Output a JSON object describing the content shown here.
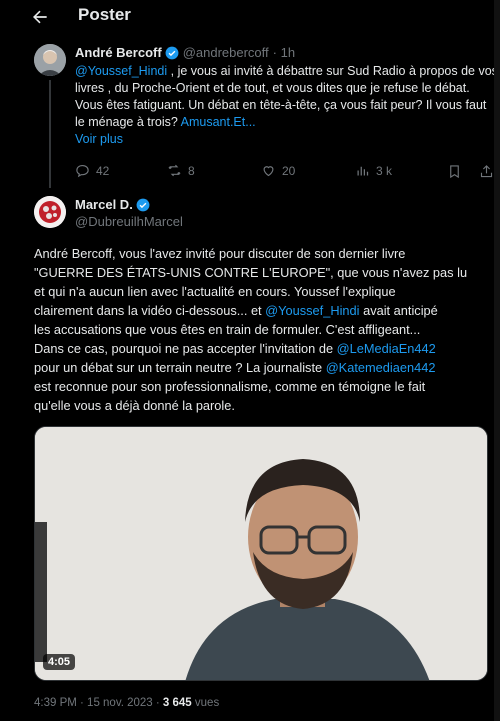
{
  "header": {
    "title": "Poster"
  },
  "parent_tweet": {
    "author_name": "André Bercoff",
    "handle": "@andrebercoff",
    "time": "· 1h",
    "mention": "@Youssef_Hindi",
    "lines": [
      " , je vous ai invité à débattre sur Sud Radio à propos de vos",
      "livres , du Proche-Orient et de tout, et vous dites que je refuse le débat.",
      "Vous êtes fatiguant. Un débat en tête-à-tête, ça vous fait peur? Il vous faut",
      "le ménage à trois? "
    ],
    "truncated_link": "Amusant.Et...",
    "show_more": "Voir plus",
    "replies": "42",
    "reposts": "8",
    "likes": "20",
    "views": "3 k"
  },
  "main_tweet": {
    "author_name": "Marcel D.",
    "handle": "@DubreuilhMarcel",
    "p1": "André Bercoff, vous l'avez invité pour discuter de son dernier livre",
    "p2": "\"GUERRE DES ÉTATS-UNIS CONTRE L'EUROPE\", que vous n'avez pas lu",
    "p3": "et qui n'a aucun lien avec l'actualité en cours. Youssef l'explique",
    "p4a": "clairement  dans la  vidéo ci-dessous... et ",
    "mention1": "@Youssef_Hindi",
    "p4b": " avait anticipé",
    "p5": "les accusations que vous êtes en train de formuler. C'est affligeant...",
    "p6a": "Dans ce cas, pourquoi ne pas accepter l'invitation de ",
    "mention2": "@LeMediaEn442",
    "p7": "pour un débat sur un terrain neutre ? La journaliste ",
    "mention3": "@Katemediaen442",
    "p8": "est reconnue pour son professionnalisme, comme en témoigne le fait",
    "p9": "qu'elle vous a déjà donné la parole.",
    "video_duration": "4:05",
    "timestamp": "4:39 PM · 15 nov. 2023 · ",
    "view_count": "3 645",
    "views_label": " vues"
  },
  "colors": {
    "link": "#1d9bf0",
    "verified": "#1d9bf0",
    "muted": "#71767b",
    "background": "#000000"
  },
  "icons": [
    "back-arrow-icon",
    "verified-badge-icon",
    "reply-icon",
    "repost-icon",
    "like-icon",
    "views-icon",
    "bookmark-icon",
    "share-icon"
  ]
}
